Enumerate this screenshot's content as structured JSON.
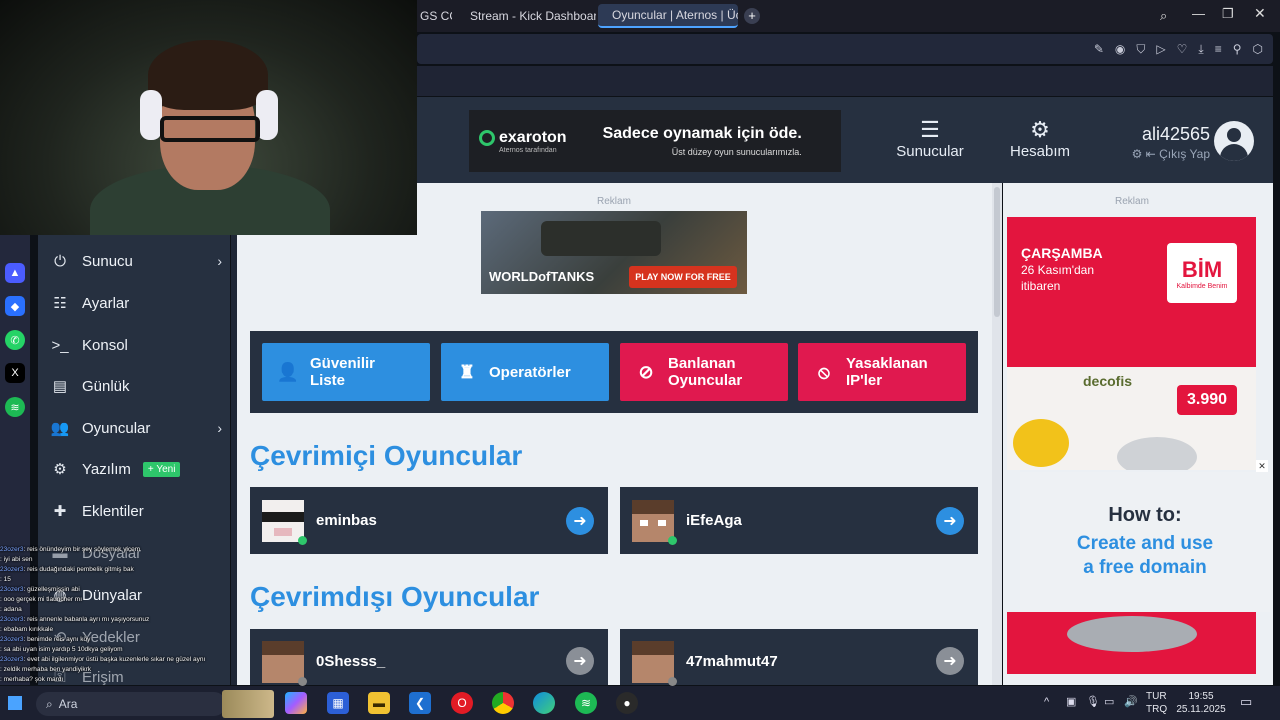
{
  "browser": {
    "tabs": [
      {
        "label": "GS COĞ"
      },
      {
        "label": "Stream - Kick Dashboard"
      },
      {
        "label": "Oyuncular | Aternos | Ücre"
      }
    ]
  },
  "header": {
    "ad_brand": "exaroton",
    "ad_brand_sub": "Aternos tarafından",
    "ad_headline": "Sadece oynamak için öde.",
    "ad_subline": "Üst düzey oyun sunucularımızla.",
    "nav_servers": "Sunucular",
    "nav_account": "Hesabım",
    "username": "ali42565",
    "logout": "Çıkış Yap"
  },
  "sidebar": {
    "items": [
      {
        "label": "Sunucu"
      },
      {
        "label": "Ayarlar"
      },
      {
        "label": "Konsol"
      },
      {
        "label": "Günlük"
      },
      {
        "label": "Oyuncular"
      },
      {
        "label": "Yazılım"
      },
      {
        "label": "Eklentiler"
      },
      {
        "label": "Dosyalar"
      },
      {
        "label": "Dünyalar"
      },
      {
        "label": "Yedekler"
      },
      {
        "label": "Erişim"
      }
    ],
    "new_badge": "Yeni"
  },
  "ads": {
    "label": "Reklam",
    "wot_logo": "WORLDofTANKS",
    "wot_cta": "PLAY NOW FOR FREE",
    "side_day": "ÇARŞAMBA",
    "side_date": "26 Kasım'dan",
    "side_from": "itibaren",
    "side_brand": "BİM",
    "side_brand_sub": "Kalbimde Benim",
    "side_product": "decofis",
    "side_price": "3.990",
    "howto_title": "How to:",
    "howto_line1": "Create and use",
    "howto_line2": "a free domain"
  },
  "quick_actions": [
    {
      "label": "Güvenilir Liste"
    },
    {
      "label": "Operatörler"
    },
    {
      "label": "Banlanan Oyuncular"
    },
    {
      "label": "Yasaklanan IP'ler"
    }
  ],
  "online": {
    "title": "Çevrimiçi Oyuncular",
    "players": [
      "eminbas",
      "iEfeAga"
    ]
  },
  "offline": {
    "title": "Çevrimdışı Oyuncular",
    "players": [
      "0Shesss_",
      "47mahmut47"
    ]
  },
  "chat": [
    {
      "user": "23ozer3",
      "msg": "reis önündeyim bir şey söylemek yicem"
    },
    {
      "user": "",
      "msg": "iyi abi sen"
    },
    {
      "user": "23ozer3",
      "msg": "reis dudağındaki pembelik gitmiş bak"
    },
    {
      "user": "",
      "msg": "15"
    },
    {
      "user": "23ozer3",
      "msg": "güzelleşmişsin abi"
    },
    {
      "user": "",
      "msg": "ooo gerçek mi tlauncher mı"
    },
    {
      "user": "",
      "msg": "adana"
    },
    {
      "user": "23ozer3",
      "msg": "reis annenle babanla ayrı mı yaşıyorsunuz"
    },
    {
      "user": "",
      "msg": "ebabam kırıkkale"
    },
    {
      "user": "23ozer3",
      "msg": "benimde reis aynı köy"
    },
    {
      "user": "",
      "msg": "sa abi uyan isim yardıp 5 10dkya geliyom"
    },
    {
      "user": "23ozer3",
      "msg": "evet abi ilgilenmiyor üstü başka kuzenlerle sıkar ne güzel aynı"
    },
    {
      "user": "",
      "msg": "zeldik merhaba ben yandiyikrk"
    },
    {
      "user": "",
      "msg": "merhaba? şok mardı"
    }
  ],
  "taskbar": {
    "search": "Ara",
    "lang": "TUR",
    "lang_sub": "TRQ",
    "time": "19:55",
    "date": "25.11.2025"
  },
  "colors": {
    "aternos_dark": "#263040",
    "accent_blue": "#2d8fe0",
    "quick_blue": "#2d8fe0",
    "quick_red": "#e0194f",
    "online_green": "#2ec66b"
  }
}
